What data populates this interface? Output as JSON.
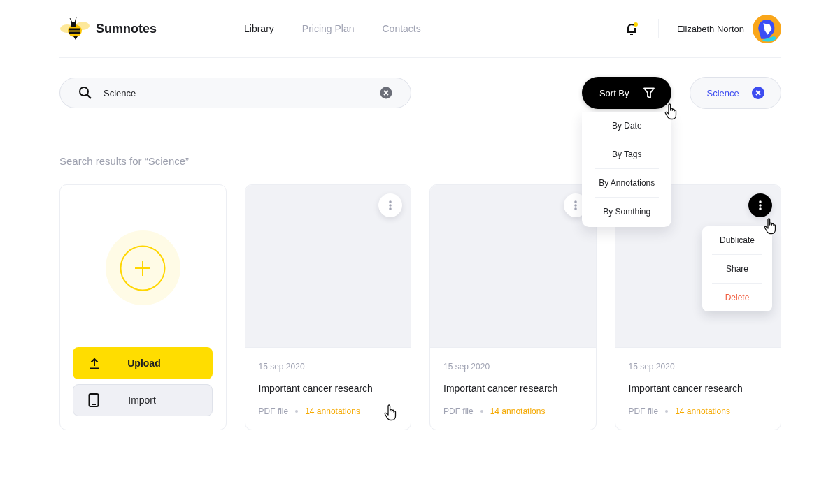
{
  "app": {
    "name": "Sumnotes"
  },
  "nav": [
    {
      "label": "Library",
      "selected": true
    },
    {
      "label": "Pricing Plan",
      "selected": false
    },
    {
      "label": "Contacts",
      "selected": false
    }
  ],
  "notifications": {
    "unread": true
  },
  "user": {
    "name": "Elizabeth Norton"
  },
  "search": {
    "value": "Science"
  },
  "sort": {
    "label": "Sort By",
    "open": true,
    "hovered": true,
    "options": [
      "By Date",
      "By Tags",
      "By Annotations",
      "By Somthing"
    ]
  },
  "filter_tag": {
    "label": "Science"
  },
  "results_heading": "Search results for “Science”",
  "upload_card": {
    "buttons": [
      {
        "label": "Upload",
        "kind": "upload"
      },
      {
        "label": "Import",
        "kind": "import"
      }
    ]
  },
  "documents": [
    {
      "date": "15 sep 2020",
      "title": "Important cancer research",
      "file_type": "PDF file",
      "annotations": "14 annotations",
      "hovered": true,
      "menu_active": false
    },
    {
      "date": "15 sep 2020",
      "title": "Important cancer research",
      "file_type": "PDF file",
      "annotations": "14 annotations",
      "hovered": false,
      "menu_active": false
    },
    {
      "date": "15 sep 2020",
      "title": "Important cancer research",
      "file_type": "PDF file",
      "annotations": "14 annotations",
      "hovered": false,
      "menu_active": true,
      "menu": [
        {
          "label": "Dublicate",
          "kind": "normal"
        },
        {
          "label": "Share",
          "kind": "normal"
        },
        {
          "label": "Delete",
          "kind": "danger"
        }
      ]
    }
  ]
}
